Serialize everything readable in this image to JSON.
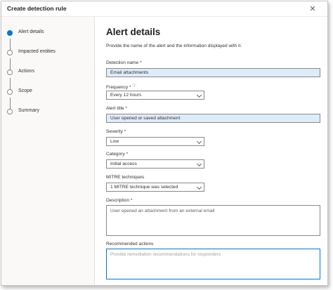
{
  "dialog": {
    "title": "Create detection rule",
    "close_glyph": "✕"
  },
  "steps": [
    {
      "label": "Alert details",
      "active": true
    },
    {
      "label": "Impacted entities",
      "active": false
    },
    {
      "label": "Actions",
      "active": false
    },
    {
      "label": "Scope",
      "active": false
    },
    {
      "label": "Summary",
      "active": false
    }
  ],
  "main": {
    "title": "Alert details",
    "description": "Provide the name of the alert and the information displayed with it."
  },
  "form": {
    "detection_name": {
      "label": "Detection name *",
      "value": "Email attachments"
    },
    "frequency": {
      "label": "Frequency *",
      "value": "Every 12 hours",
      "info_glyph": "ⓘ"
    },
    "alert_title": {
      "label": "Alert title *",
      "value": "User opened or saved attachment"
    },
    "severity": {
      "label": "Severity *",
      "value": "Low"
    },
    "category": {
      "label": "Category *",
      "value": "Initial access"
    },
    "mitre": {
      "label": "MITRE techniques",
      "value": "1 MITRE technique was selected"
    },
    "description": {
      "label": "Description *",
      "value": "User opened an attachment from an external email"
    },
    "recommended": {
      "label": "Recommended actions",
      "placeholder": "Provide remediation recommendations for responders"
    }
  },
  "colors": {
    "accent": "#0078d4",
    "filled_field": "#deecf9"
  }
}
